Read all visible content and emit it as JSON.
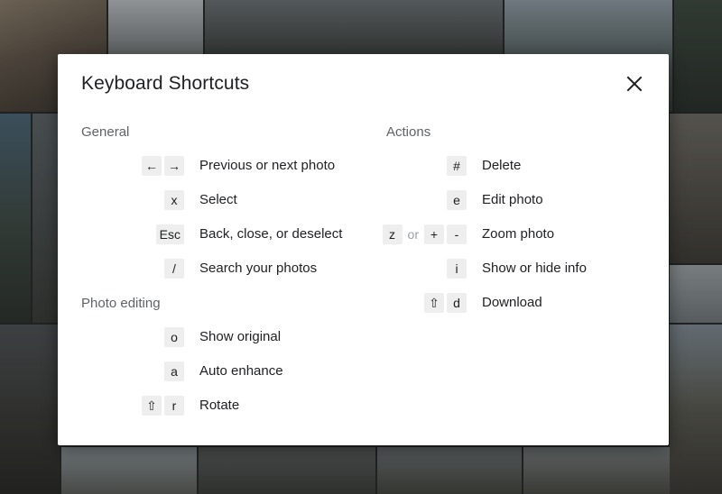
{
  "dialog": {
    "title": "Keyboard Shortcuts",
    "close_icon": "close-icon"
  },
  "general": {
    "heading": "General",
    "items": [
      {
        "keys": [
          "←",
          "→"
        ],
        "label": "Previous or next photo"
      },
      {
        "keys": [
          "x"
        ],
        "label": "Select"
      },
      {
        "keys": [
          "Esc"
        ],
        "label": "Back, close, or deselect"
      },
      {
        "keys": [
          "/"
        ],
        "label": "Search your photos"
      }
    ]
  },
  "photo_editing": {
    "heading": "Photo editing",
    "items": [
      {
        "keys": [
          "o"
        ],
        "label": "Show original"
      },
      {
        "keys": [
          "a"
        ],
        "label": "Auto enhance"
      },
      {
        "keys": [
          "⇧",
          "r"
        ],
        "label": "Rotate"
      }
    ]
  },
  "actions": {
    "heading": "Actions",
    "items": [
      {
        "keys": [
          "#"
        ],
        "label": "Delete"
      },
      {
        "keys": [
          "e"
        ],
        "label": "Edit photo"
      },
      {
        "keys": [
          "z",
          "+",
          "-"
        ],
        "separator": "or",
        "label": "Zoom photo"
      },
      {
        "keys": [
          "i"
        ],
        "label": "Show or hide info"
      },
      {
        "keys": [
          "⇧",
          "d"
        ],
        "label": "Download"
      }
    ]
  },
  "colors": {
    "dialog_bg": "#ffffff",
    "key_bg": "#eeeeee",
    "heading_text": "#5f6368",
    "body_text": "#202124",
    "separator_text": "#9aa0a6"
  }
}
